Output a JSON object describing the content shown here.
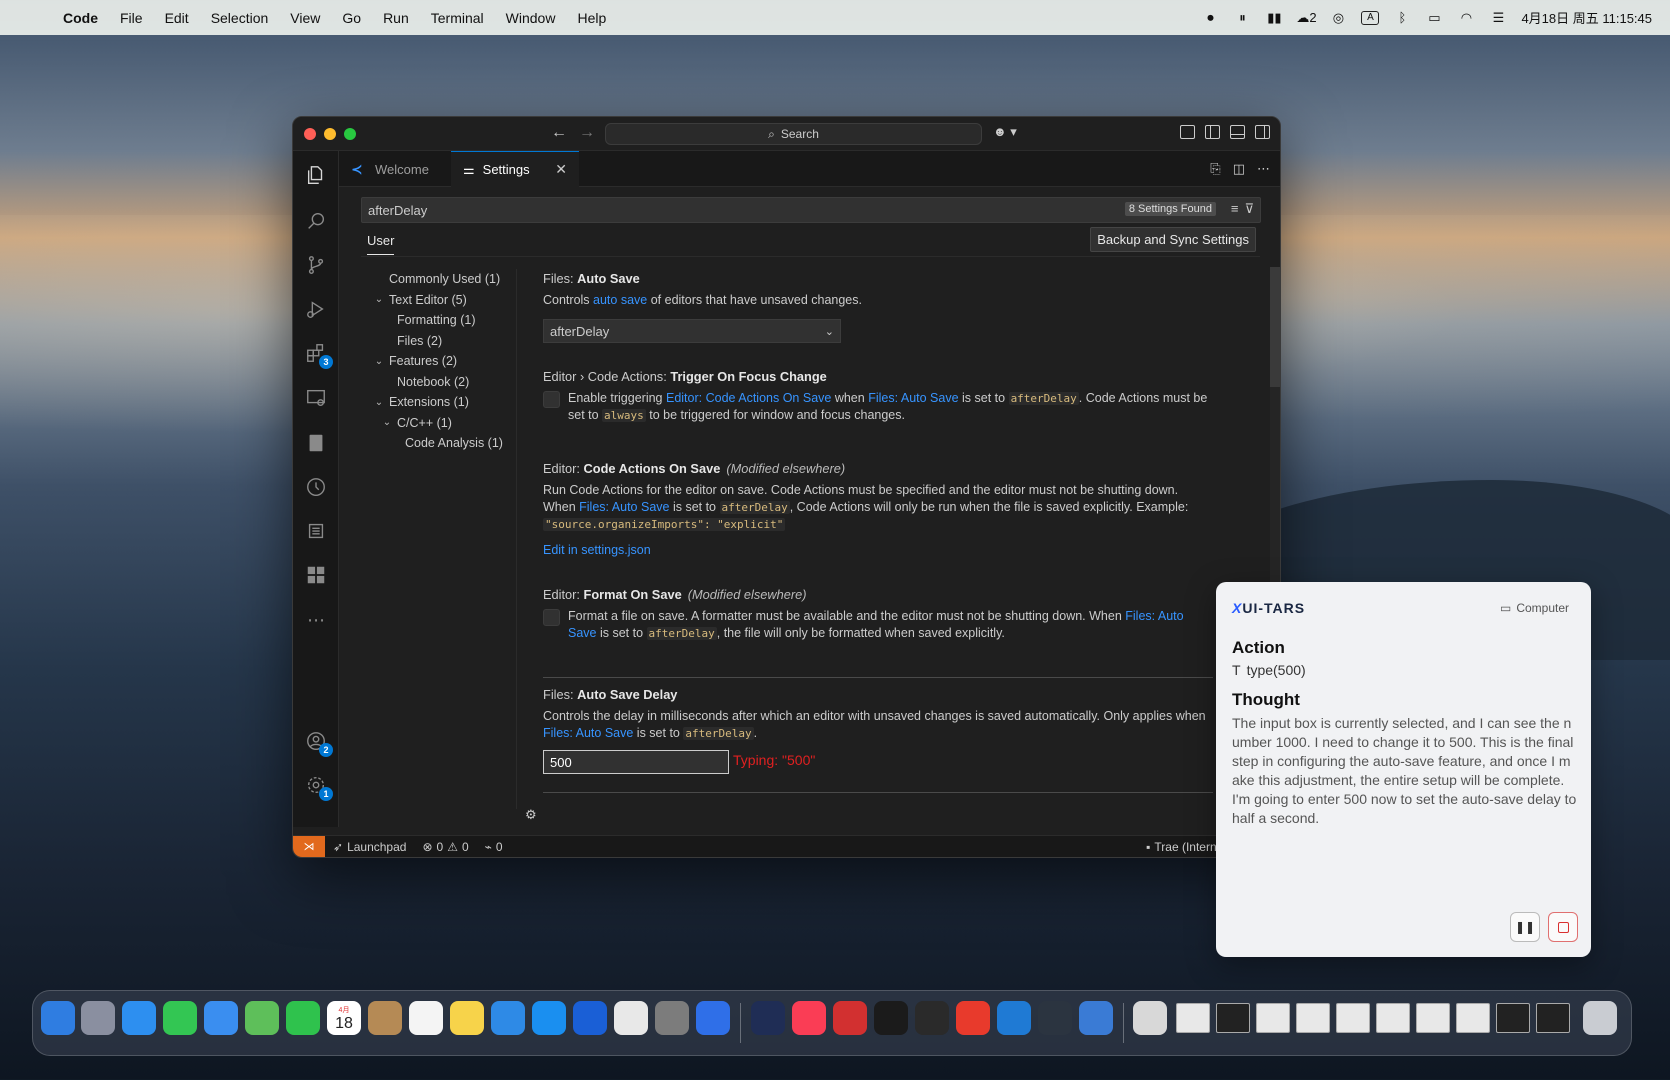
{
  "menubar": {
    "app_name": "Code",
    "items": [
      "File",
      "Edit",
      "Selection",
      "View",
      "Go",
      "Run",
      "Terminal",
      "Window",
      "Help"
    ],
    "status_count": "2",
    "input_indicator": "A",
    "datetime": "4月18日 周五 11:15:45"
  },
  "window": {
    "search_placeholder": "Search",
    "tabs": [
      {
        "label": "Welcome"
      },
      {
        "label": "Settings"
      }
    ],
    "activity_badges": {
      "extensions": "3",
      "accounts": "2",
      "manage": "1"
    }
  },
  "settings": {
    "search_value": "afterDelay",
    "found_label": "8 Settings Found",
    "scope_tab": "User",
    "sync_button": "Backup and Sync Settings",
    "toc": [
      {
        "label": "Commonly Used (1)",
        "indent": 0,
        "chevron": ""
      },
      {
        "label": "Text Editor (5)",
        "indent": 0,
        "chevron": "v"
      },
      {
        "label": "Formatting (1)",
        "indent": 1,
        "chevron": ""
      },
      {
        "label": "Files (2)",
        "indent": 1,
        "chevron": ""
      },
      {
        "label": "Features (2)",
        "indent": 0,
        "chevron": "v"
      },
      {
        "label": "Notebook (2)",
        "indent": 1,
        "chevron": ""
      },
      {
        "label": "Extensions (1)",
        "indent": 0,
        "chevron": "v"
      },
      {
        "label": "C/C++ (1)",
        "indent": 1,
        "chevron": "v"
      },
      {
        "label": "Code Analysis (1)",
        "indent": 2,
        "chevron": ""
      }
    ],
    "auto_save": {
      "prefix": "Files: ",
      "name": "Auto Save",
      "desc_a": "Controls ",
      "desc_link": "auto save",
      "desc_b": " of editors that have unsaved changes.",
      "value": "afterDelay"
    },
    "trigger_focus": {
      "prefix": "Editor › Code Actions: ",
      "name": "Trigger On Focus Change",
      "d1": "Enable triggering ",
      "l1": "Editor: Code Actions On Save",
      "d2": " when ",
      "l2": "Files: Auto Save",
      "d3": " is set to ",
      "c1": "afterDelay",
      "d4": ". Code Actions must be set to ",
      "c2": "always",
      "d5": " to be triggered for window and focus changes."
    },
    "code_actions_on_save": {
      "prefix": "Editor: ",
      "name": "Code Actions On Save",
      "modified": "(Modified elsewhere)",
      "d1": "Run Code Actions for the editor on save. Code Actions must be specified and the editor must not be shutting down. When ",
      "l1": "Files: Auto Save",
      "d2": " is set to ",
      "c1": "afterDelay",
      "d3": ", Code Actions will only be run when the file is saved explicitly. Example: ",
      "c2": "\"source.organizeImports\": \"explicit\"",
      "edit_link": "Edit in settings.json"
    },
    "format_on_save": {
      "prefix": "Editor: ",
      "name": "Format On Save",
      "modified": "(Modified elsewhere)",
      "d1": "Format a file on save. A formatter must be available and the editor must not be shutting down. When ",
      "l1": "Files: Auto Save",
      "d2": " is set to ",
      "c1": "afterDelay",
      "d3": ", the file will only be formatted when saved explicitly."
    },
    "auto_save_delay": {
      "prefix": "Files: ",
      "name": "Auto Save Delay",
      "d1": "Controls the delay in milliseconds after which an editor with unsaved changes is saved automatically. Only applies when ",
      "l1": "Files: Auto Save",
      "d2": " is set to ",
      "c1": "afterDelay",
      "d3": ".",
      "value": "500",
      "typing_note": "Typing: \"500\""
    }
  },
  "statusbar": {
    "launchpad": "Launchpad",
    "errors": "0",
    "warnings": "0",
    "ports": "0",
    "account": "Trae (Internal)"
  },
  "agent": {
    "logo": "UI-TARS",
    "mode": "Computer",
    "action_heading": "Action",
    "action": "type(500)",
    "thought_heading": "Thought",
    "thought": "The input box is currently selected, and I can see the number 1000. I need to change it to 500. This is the final step in configuring the auto-save feature, and once I make this adjustment, the entire setup will be complete. I'm going to enter 500 now to set the auto-save delay to half a second."
  },
  "dock": {
    "calendar_month": "4月",
    "calendar_day": "18"
  },
  "colors": {
    "accent": "#0078d4",
    "link": "#3794ff",
    "remote": "#e2691d",
    "typing": "#e02020"
  }
}
